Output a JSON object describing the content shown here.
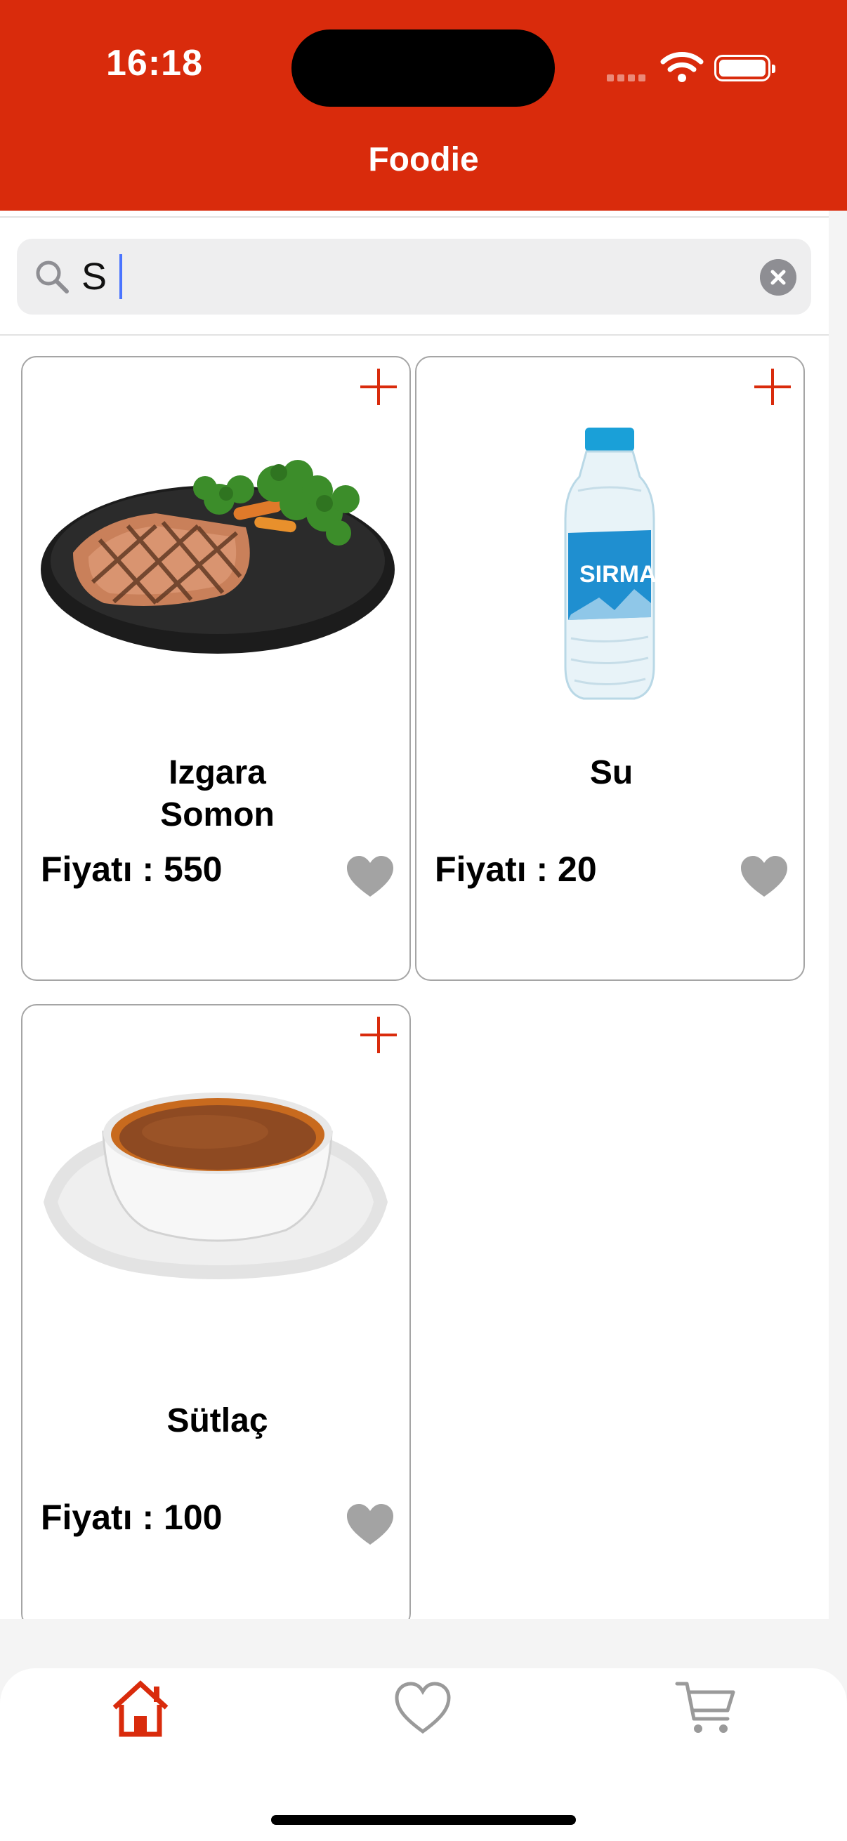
{
  "status": {
    "time": "16:18"
  },
  "app": {
    "title": "Foodie"
  },
  "search": {
    "value": "S",
    "placeholder": ""
  },
  "products": [
    {
      "name": "Izgara\nSomon",
      "price": "Fiyatı : 550",
      "image": "grilled-salmon-image"
    },
    {
      "name": "Su",
      "price": "Fiyatı : 20",
      "image": "water-bottle-image"
    },
    {
      "name": "Sütlaç",
      "price": "Fiyatı : 100",
      "image": "rice-pudding-image"
    }
  ],
  "tabs": [
    {
      "name": "home",
      "icon": "home-icon",
      "active": true
    },
    {
      "name": "favorites",
      "icon": "heart-icon",
      "active": false
    },
    {
      "name": "cart",
      "icon": "cart-icon",
      "active": false
    }
  ],
  "colors": {
    "brand": "#d92b0c",
    "heart": "#a3a3a3",
    "inactive": "#9a9a9a",
    "card_border": "#a5a5a5"
  }
}
